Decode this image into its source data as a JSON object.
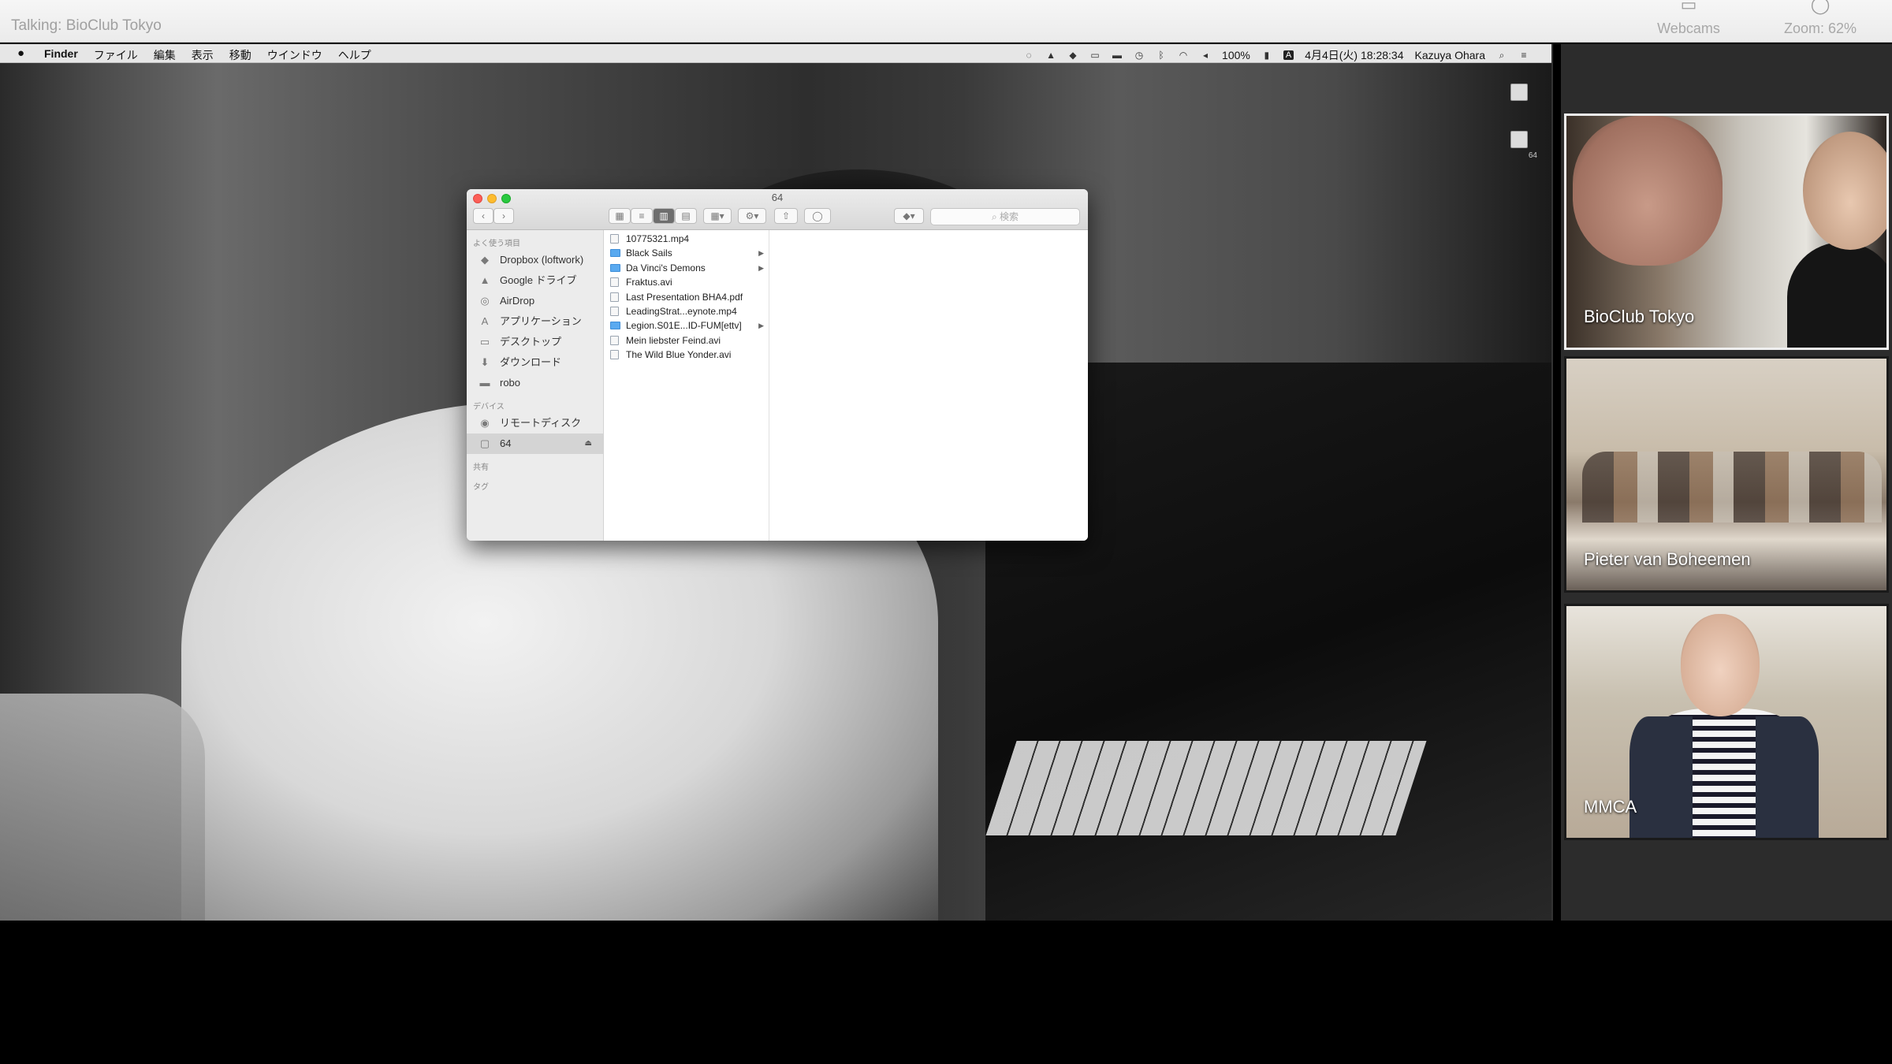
{
  "zoom": {
    "talking": "Talking: BioClub Tokyo",
    "webcams_label": "Webcams",
    "zoom_label": "Zoom: 62%"
  },
  "menubar": {
    "items": [
      "Finder",
      "ファイル",
      "編集",
      "表示",
      "移動",
      "ウインドウ",
      "ヘルプ"
    ],
    "battery": "100%",
    "input_source": "A",
    "datetime": "4月4日(火) 18:28:34",
    "user": "Kazuya Ohara"
  },
  "desktop": {
    "icon_label": "64"
  },
  "finder": {
    "title": "64",
    "search_placeholder": "検索",
    "sidebar": {
      "favorites_header": "よく使う項目",
      "favorites": [
        "Dropbox (loftwork)",
        "Google ドライブ",
        "AirDrop",
        "アプリケーション",
        "デスクトップ",
        "ダウンロード",
        "robo"
      ],
      "devices_header": "デバイス",
      "devices": [
        "リモートディスク",
        "64"
      ],
      "shared_header": "共有",
      "tags_header": "タグ"
    },
    "files": [
      {
        "name": "10775321.mp4",
        "folder": false
      },
      {
        "name": "Black Sails",
        "folder": true
      },
      {
        "name": "Da Vinci's Demons",
        "folder": true
      },
      {
        "name": "Fraktus.avi",
        "folder": false
      },
      {
        "name": "Last Presentation BHA4.pdf",
        "folder": false
      },
      {
        "name": "LeadingStrat...eynote.mp4",
        "folder": false
      },
      {
        "name": "Legion.S01E...ID-FUM[ettv]",
        "folder": true
      },
      {
        "name": "Mein liebster Feind.avi",
        "folder": false
      },
      {
        "name": "The Wild Blue Yonder.avi",
        "folder": false
      }
    ]
  },
  "participants": [
    {
      "name": "BioClub Tokyo",
      "active": true
    },
    {
      "name": "Pieter van Boheemen",
      "active": false
    },
    {
      "name": "MMCA",
      "active": false
    }
  ]
}
